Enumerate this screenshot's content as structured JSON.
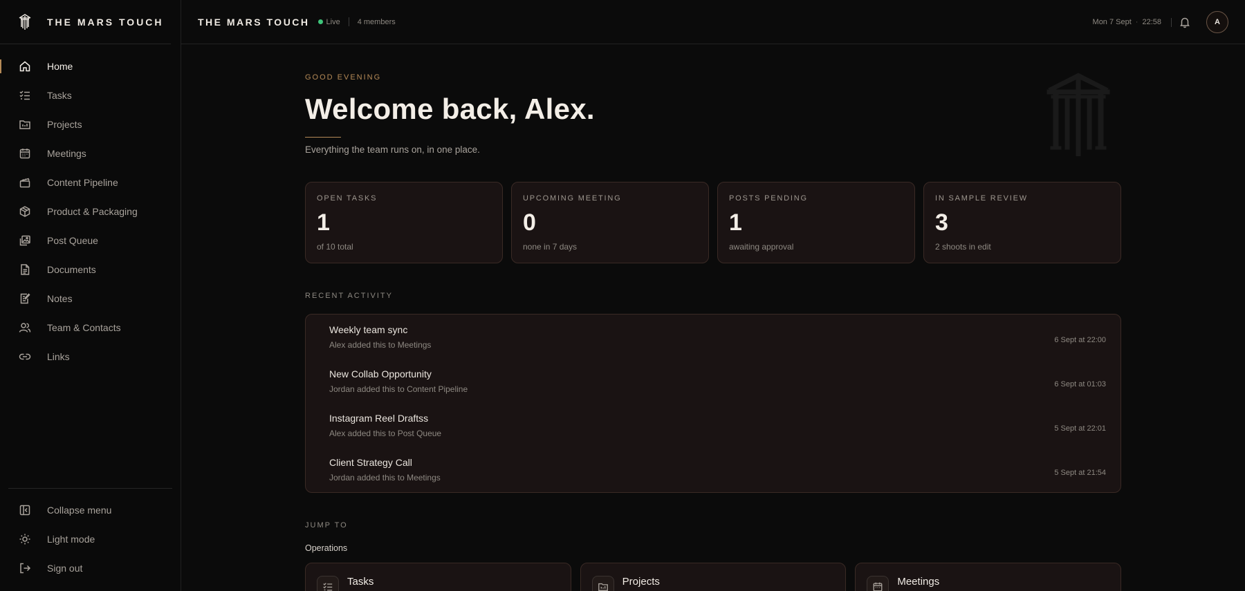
{
  "brand": {
    "name": "THE MARS TOUCH"
  },
  "sidebar": {
    "items": [
      {
        "label": "Home",
        "icon": "home-icon",
        "active": true
      },
      {
        "label": "Tasks",
        "icon": "tasks-icon"
      },
      {
        "label": "Projects",
        "icon": "projects-icon"
      },
      {
        "label": "Meetings",
        "icon": "calendar-icon"
      },
      {
        "label": "Content Pipeline",
        "icon": "clapperboard-icon"
      },
      {
        "label": "Product & Packaging",
        "icon": "package-icon"
      },
      {
        "label": "Post Queue",
        "icon": "images-icon"
      },
      {
        "label": "Documents",
        "icon": "document-icon"
      },
      {
        "label": "Notes",
        "icon": "notes-icon"
      },
      {
        "label": "Team & Contacts",
        "icon": "users-icon"
      },
      {
        "label": "Links",
        "icon": "link-icon"
      }
    ],
    "bottom": [
      {
        "label": "Collapse menu",
        "icon": "collapse-icon"
      },
      {
        "label": "Light mode",
        "icon": "sun-icon"
      },
      {
        "label": "Sign out",
        "icon": "sign-out-icon"
      }
    ]
  },
  "topbar": {
    "workspace": "THE MARS TOUCH",
    "status": "Live",
    "members": "4 members",
    "date": "Mon 7 Sept",
    "time": "22:58",
    "avatar_initial": "A"
  },
  "colors": {
    "accent": "#b58a57",
    "live": "#3ec47a",
    "card_bg": "#1a1313",
    "card_border": "#3a2a25"
  },
  "hero": {
    "greeting": "GOOD EVENING",
    "title": "Welcome back, Alex.",
    "subtitle": "Everything the team runs on, in one place."
  },
  "stats": [
    {
      "label": "OPEN TASKS",
      "value": "1",
      "sub": "of 10 total"
    },
    {
      "label": "UPCOMING MEETING",
      "value": "0",
      "sub": "none in 7 days"
    },
    {
      "label": "POSTS PENDING",
      "value": "1",
      "sub": "awaiting approval"
    },
    {
      "label": "IN SAMPLE REVIEW",
      "value": "3",
      "sub": "2 shoots in edit"
    }
  ],
  "activity": {
    "heading": "RECENT ACTIVITY",
    "items": [
      {
        "title": "Weekly team sync",
        "sub": "Alex added this to Meetings",
        "time": "6 Sept at 22:00"
      },
      {
        "title": "New Collab Opportunity",
        "sub": "Jordan added this to Content Pipeline",
        "time": "6 Sept at 01:03"
      },
      {
        "title": "Instagram Reel Draftss",
        "sub": "Alex added this to Post Queue",
        "time": "5 Sept at 22:01"
      },
      {
        "title": "Client Strategy Call",
        "sub": "Jordan added this to Meetings",
        "time": "5 Sept at 21:54"
      }
    ]
  },
  "jump": {
    "heading": "JUMP TO",
    "group": "Operations",
    "cards": [
      {
        "title": "Tasks",
        "icon": "tasks-icon"
      },
      {
        "title": "Projects",
        "icon": "projects-icon"
      },
      {
        "title": "Meetings",
        "icon": "calendar-icon"
      }
    ]
  }
}
